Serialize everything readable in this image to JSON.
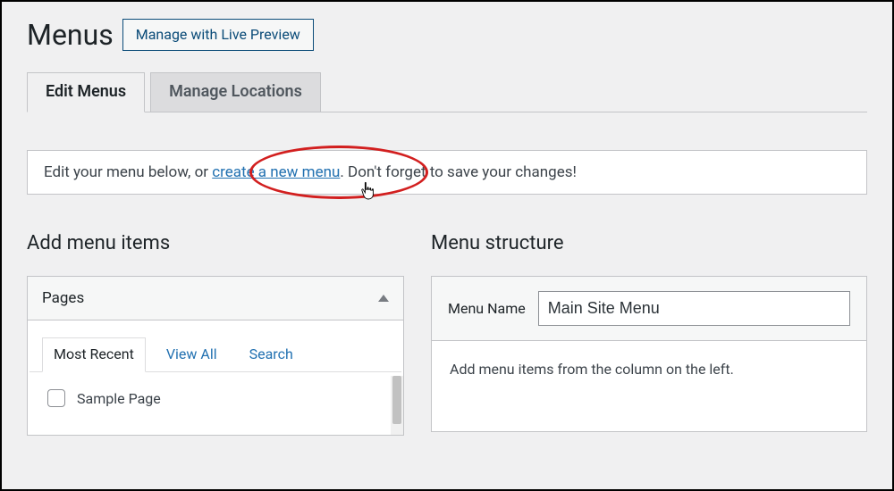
{
  "header": {
    "title": "Menus",
    "live_preview_label": "Manage with Live Preview"
  },
  "tabs": {
    "edit": "Edit Menus",
    "locations": "Manage Locations"
  },
  "notice": {
    "prefix": "Edit your menu below, or ",
    "link": "create a new menu",
    "suffix": ". Don't forget to save your changes!"
  },
  "left": {
    "title": "Add menu items",
    "pages_heading": "Pages",
    "subtabs": {
      "recent": "Most Recent",
      "view_all": "View All",
      "search": "Search"
    },
    "items": [
      "Sample Page"
    ]
  },
  "right": {
    "title": "Menu structure",
    "menu_name_label": "Menu Name",
    "menu_name_value": "Main Site Menu",
    "body_text": "Add menu items from the column on the left."
  }
}
